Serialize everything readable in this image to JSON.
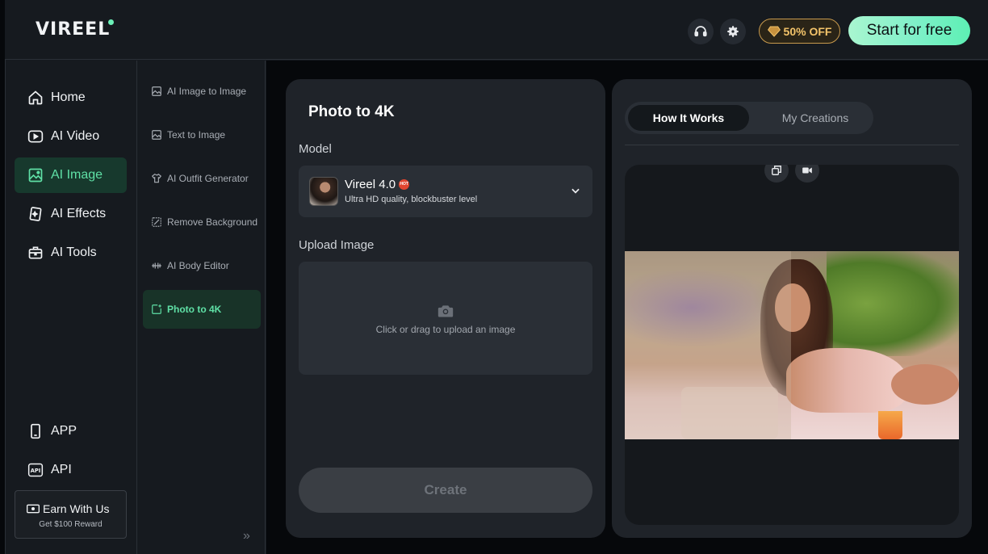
{
  "brand": {
    "logo_text": "VIREEL"
  },
  "header": {
    "offer_label": "50% OFF",
    "start_label": "Start for free",
    "colors": {
      "accent": "#5fe0a6",
      "offer": "#f4c46a"
    }
  },
  "nav": {
    "items": [
      {
        "label": "Home",
        "icon": "home-icon"
      },
      {
        "label": "AI Video",
        "icon": "video-icon"
      },
      {
        "label": "AI Image",
        "icon": "image-icon",
        "active": true
      },
      {
        "label": "AI Effects",
        "icon": "effects-icon"
      },
      {
        "label": "AI Tools",
        "icon": "toolbox-icon"
      }
    ],
    "bottom": [
      {
        "label": "APP",
        "icon": "phone-icon"
      },
      {
        "label": "API",
        "icon": "api-icon"
      }
    ],
    "earn": {
      "title": "Earn With Us",
      "subtitle": "Get $100 Reward"
    }
  },
  "subnav": {
    "items": [
      {
        "label": "AI Image to Image",
        "icon": "image-icon"
      },
      {
        "label": "Text to Image",
        "icon": "image-icon"
      },
      {
        "label": "AI Outfit Generator",
        "icon": "shirt-icon"
      },
      {
        "label": "Remove Background",
        "icon": "remove-bg-icon"
      },
      {
        "label": "AI Body Editor",
        "icon": "body-editor-icon"
      },
      {
        "label": "Photo to 4K",
        "icon": "upscale-icon",
        "active": true
      }
    ]
  },
  "form": {
    "title": "Photo to 4K",
    "model_label": "Model",
    "model": {
      "name": "Vireel 4.0",
      "badge": "HOT",
      "description": "Ultra HD quality, blockbuster level"
    },
    "upload_label": "Upload Image",
    "upload_hint": "Click or drag to upload an image",
    "create_label": "Create"
  },
  "preview": {
    "tabs": [
      {
        "label": "How It Works",
        "active": true
      },
      {
        "label": "My Creations",
        "active": false
      }
    ]
  }
}
